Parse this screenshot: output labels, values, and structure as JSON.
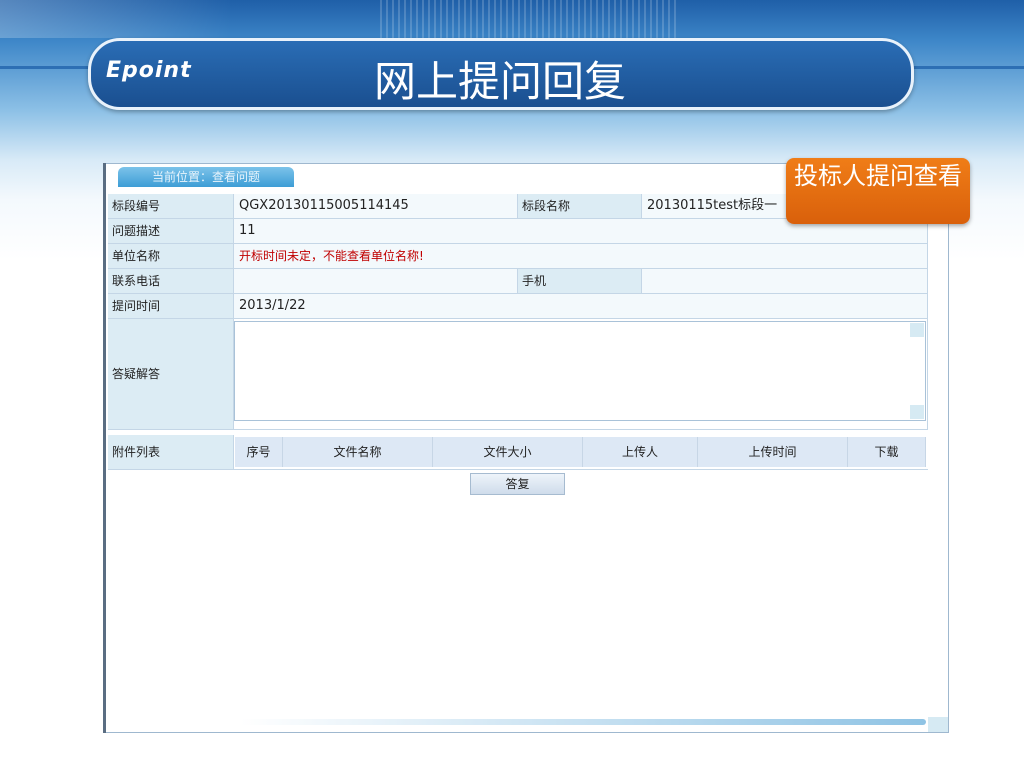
{
  "slide": {
    "logo": "Epoint",
    "title": "网上提问回复",
    "callout": "投标人提问查看"
  },
  "panel": {
    "tab": "当前位置：查看问题"
  },
  "form": {
    "bid_section_no_label": "标段编号",
    "bid_section_no_value": "QGX20130115005114145",
    "bid_section_name_label": "标段名称",
    "bid_section_name_value": "20130115test标段一",
    "question_desc_label": "问题描述",
    "question_desc_value": "11",
    "unit_name_label": "单位名称",
    "unit_name_value": "开标时间未定，不能查看单位名称!",
    "phone_label": "联系电话",
    "phone_value": "",
    "mobile_label": "手机",
    "mobile_value": "",
    "question_time_label": "提问时间",
    "question_time_value": "2013/1/22",
    "answer_label": "答疑解答",
    "answer_value": "",
    "attachments_label": "附件列表"
  },
  "attachments_table": {
    "columns": [
      "序号",
      "文件名称",
      "文件大小",
      "上传人",
      "上传时间",
      "下载"
    ]
  },
  "actions": {
    "answer_button": "答复"
  },
  "colors": {
    "title_bar": "#1a4f90",
    "callout": "#e46c10",
    "label_cell": "#dcecf4",
    "warning_text": "#c00000"
  }
}
